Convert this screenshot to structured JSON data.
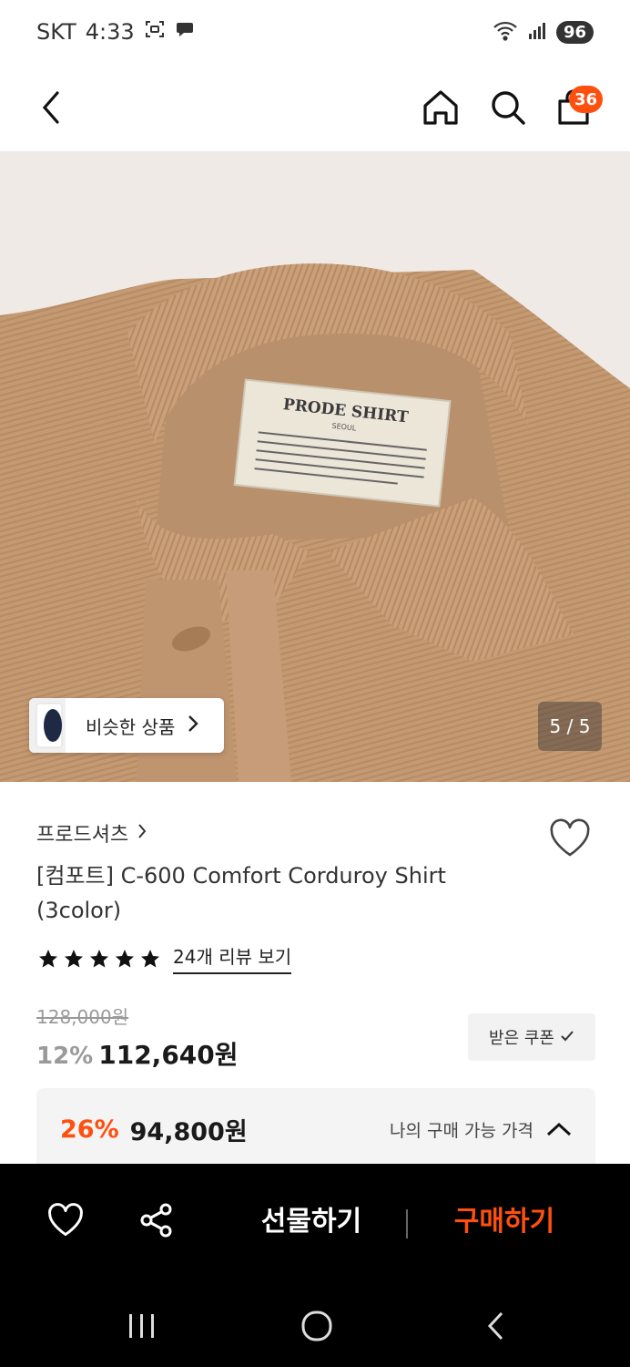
{
  "status_bar": {
    "carrier": "SKT",
    "time": "4:33",
    "battery": "96"
  },
  "header": {
    "cart_count": "36"
  },
  "gallery": {
    "similar_label": "비슷한 상품",
    "counter": "5 / 5",
    "label_brand": "PRODE SHIRT",
    "label_city": "SEOUL"
  },
  "product": {
    "brand": "프로드셔츠",
    "title": "[컴포트] C-600 Comfort Corduroy Shirt (3color)",
    "review_link": "24개 리뷰 보기",
    "rating_stars": 5,
    "original_price": "128,000원",
    "discount": "12%",
    "price": "112,640원",
    "coupon_label": "받은 쿠폰",
    "best_discount": "26%",
    "best_price": "94,800원",
    "best_label": "나의 구매 가능 가격"
  },
  "action_bar": {
    "gift_label": "선물하기",
    "buy_label": "구매하기"
  },
  "colors": {
    "accent": "#ff4f0f",
    "fabric": "#c49a73"
  }
}
